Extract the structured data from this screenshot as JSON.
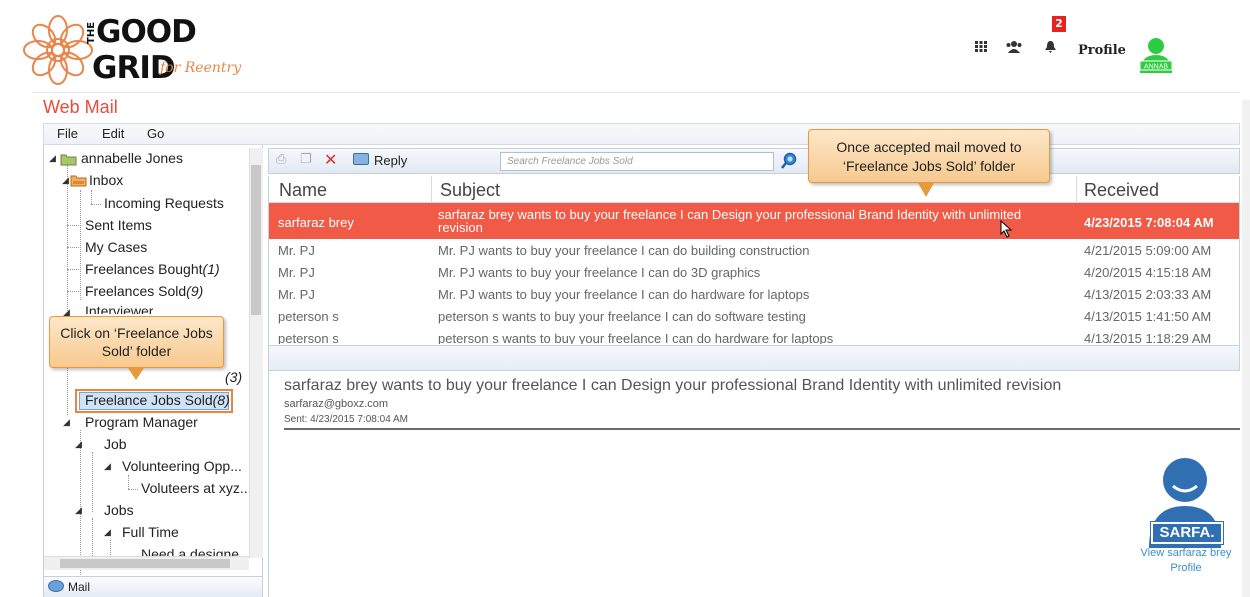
{
  "header": {
    "brand_the": "THE",
    "brand_good": "GOOD",
    "brand_grid": "GRID",
    "brand_tagline": "for Reentry",
    "notification_count": "2",
    "profile_label": "Profile",
    "user_badge": "ANNAB",
    "icons": [
      "apps-grid-icon",
      "users-icon",
      "bell-icon"
    ]
  },
  "page": {
    "title": "Web Mail"
  },
  "menu": {
    "file": "File",
    "edit": "Edit",
    "go": "Go"
  },
  "tree": {
    "root": "annabelle Jones",
    "inbox": "Inbox",
    "incoming_requests": "Incoming Requests",
    "sent_items": "Sent Items",
    "my_cases": "My Cases",
    "freelances_bought": "Freelances Bought",
    "freelances_bought_count": "(1)",
    "freelances_sold": "Freelances Sold",
    "freelances_sold_count": "(9)",
    "interviewer": "Interviewer",
    "hidden_count": "(3)",
    "freelance_jobs_sold": "Freelance Jobs Sold",
    "freelance_jobs_sold_count": "(8)",
    "program_manager": "Program Manager",
    "job": "Job",
    "volunteering": "Volunteering Opp...",
    "volunteers": "Voluteers at xyz...",
    "jobs": "Jobs",
    "full_time": "Full Time",
    "need_designer": "Need a designe"
  },
  "mail_tab": {
    "label": "Mail"
  },
  "callouts": {
    "left": "Click on ‘Freelance Jobs Sold’ folder",
    "top": "Once accepted mail moved to ‘Freelance Jobs Sold’ folder"
  },
  "toolbar": {
    "reply_label": "Reply",
    "search_placeholder": "Search Freelance Jobs Sold"
  },
  "mail_list": {
    "columns": {
      "name": "Name",
      "subject": "Subject",
      "received": "Received"
    },
    "rows": [
      {
        "name": "sarfaraz brey",
        "subject": "sarfaraz brey wants to buy your freelance I can Design your professional Brand Identity with unlimited revision",
        "received": "4/23/2015 7:08:04 AM",
        "selected": true
      },
      {
        "name": "Mr. PJ",
        "subject": "Mr. PJ wants to buy your freelance I can do building construction",
        "received": "4/21/2015 5:09:00 AM"
      },
      {
        "name": "Mr. PJ",
        "subject": "Mr. PJ wants to buy your freelance I can do 3D graphics",
        "received": "4/20/2015 4:15:18 AM"
      },
      {
        "name": "Mr. PJ",
        "subject": "Mr. PJ wants to buy your freelance I can do hardware for laptops",
        "received": "4/13/2015 2:03:33 AM"
      },
      {
        "name": "peterson s",
        "subject": "peterson s wants to buy your freelance I can do software testing",
        "received": "4/13/2015 1:41:50 AM"
      },
      {
        "name": "peterson s",
        "subject": "peterson s wants to buy your freelance I can do hardware for laptops",
        "received": "4/13/2015 1:18:29 AM"
      }
    ]
  },
  "preview": {
    "subject": "sarfaraz brey wants to buy your freelance I can Design your professional Brand Identity with unlimited revision",
    "from": "sarfaraz@gboxz.com",
    "sent": "Sent: 4/23/2015 7:08:04 AM",
    "sender_badge": "SARFA.",
    "sender_profile_link": "View sarfaraz brey Profile"
  },
  "colors": {
    "accent": "#e74c3c",
    "selected_row": "#f05a46",
    "callout_border": "#e69a3e",
    "highlight_box": "#e8863e",
    "link": "#3a8fd0"
  }
}
